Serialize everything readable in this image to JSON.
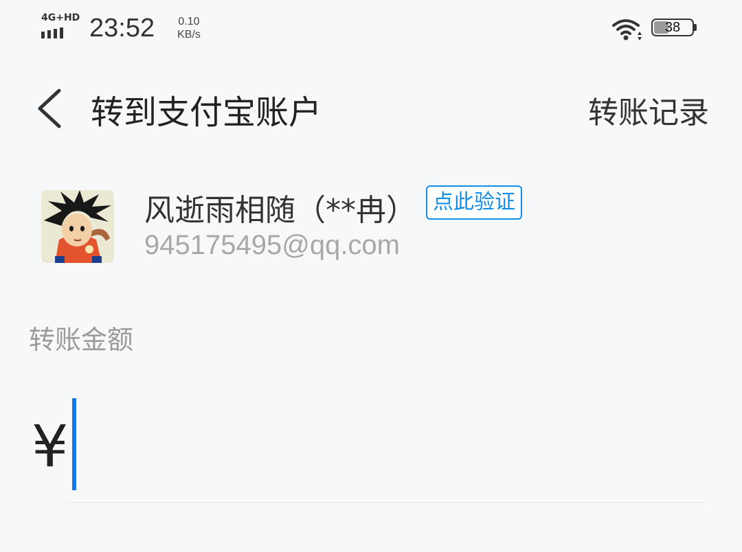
{
  "status_bar": {
    "network": "4G+HD",
    "time": "23:52",
    "speed_value": "0.10",
    "speed_unit": "KB/s",
    "battery_level": "38"
  },
  "header": {
    "title": "转到支付宝账户",
    "records_label": "转账记录"
  },
  "recipient": {
    "name": "风逝雨相随（**冉）",
    "verify_label": "点此验证",
    "account": "945175495@qq.com"
  },
  "amount": {
    "label": "转账金额",
    "currency_symbol": "¥",
    "value": ""
  },
  "colors": {
    "accent": "#108ee9",
    "cursor": "#1677e8",
    "background": "#f7f8fa"
  }
}
